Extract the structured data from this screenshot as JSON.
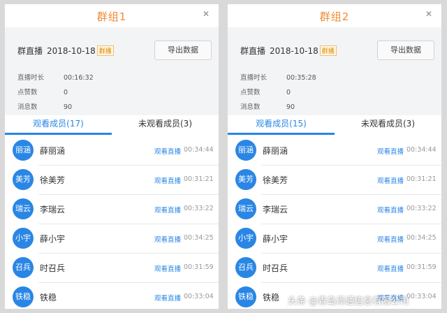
{
  "groups": [
    {
      "title": "群组1",
      "live_label": "群直播",
      "live_date": "2018-10-18",
      "badge": "群播",
      "export_label": "导出数据",
      "stats": [
        {
          "label": "直播时长",
          "value": "00:16:32"
        },
        {
          "label": "点赞数",
          "value": "0"
        },
        {
          "label": "消息数",
          "value": "90"
        }
      ],
      "tabs": [
        {
          "label": "观看成员(17)",
          "active": true
        },
        {
          "label": "未观看成员(3)",
          "active": false
        }
      ],
      "members": [
        {
          "avatar": "丽涵",
          "name": "薛丽涵",
          "action": "观看直播",
          "duration": "00:34:44"
        },
        {
          "avatar": "美芳",
          "name": "徐美芳",
          "action": "观看直播",
          "duration": "00:31:21"
        },
        {
          "avatar": "瑞云",
          "name": "李瑞云",
          "action": "观看直播",
          "duration": "00:33:22"
        },
        {
          "avatar": "小宇",
          "name": "薛小宇",
          "action": "观看直播",
          "duration": "00:34:25"
        },
        {
          "avatar": "召兵",
          "name": "时召兵",
          "action": "观看直播",
          "duration": "00:31:59"
        },
        {
          "avatar": "铁稳",
          "name": "铁稳",
          "action": "观看直播",
          "duration": "00:33:04"
        }
      ]
    },
    {
      "title": "群组2",
      "live_label": "群直播",
      "live_date": "2018-10-18",
      "badge": "群播",
      "export_label": "导出数据",
      "stats": [
        {
          "label": "直播时长",
          "value": "00:35:28"
        },
        {
          "label": "点赞数",
          "value": "0"
        },
        {
          "label": "消息数",
          "value": "90"
        }
      ],
      "tabs": [
        {
          "label": "观看成员(15)",
          "active": true
        },
        {
          "label": "未观看成员(3)",
          "active": false
        }
      ],
      "members": [
        {
          "avatar": "丽涵",
          "name": "薛丽涵",
          "action": "观看直播",
          "duration": "00:34:44"
        },
        {
          "avatar": "美芳",
          "name": "徐美芳",
          "action": "观看直播",
          "duration": "00:31:21"
        },
        {
          "avatar": "瑞云",
          "name": "李瑞云",
          "action": "观看直播",
          "duration": "00:33:22"
        },
        {
          "avatar": "小宇",
          "name": "薛小宇",
          "action": "观看直播",
          "duration": "00:34:25"
        },
        {
          "avatar": "召兵",
          "name": "时召兵",
          "action": "观看直播",
          "duration": "00:31:59"
        },
        {
          "avatar": "铁稳",
          "name": "铁稳",
          "action": "观看直播",
          "duration": "00:33:04"
        }
      ]
    }
  ],
  "watermark": "头条 @青岛泽通信息有限公司",
  "colors": {
    "accent": "#2a86e5",
    "title": "#f08a30"
  }
}
